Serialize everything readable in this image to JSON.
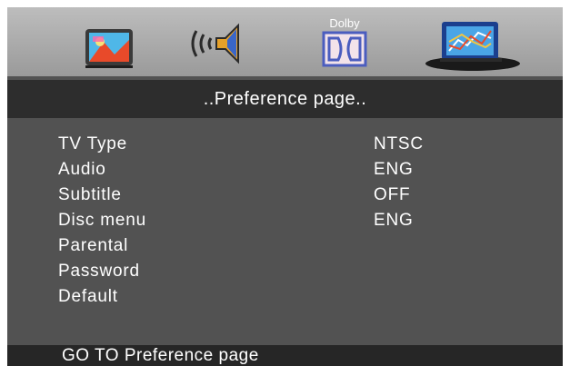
{
  "tabs": [
    {
      "name": "general-setup-icon"
    },
    {
      "name": "audio-setup-icon"
    },
    {
      "name": "dolby-setup-icon",
      "label": "Dolby"
    },
    {
      "name": "preference-setup-icon",
      "selected": true
    }
  ],
  "header": {
    "title": "..Preference page.."
  },
  "menu": {
    "items": [
      {
        "label": "TV Type",
        "value": "NTSC"
      },
      {
        "label": "Audio",
        "value": "ENG"
      },
      {
        "label": "Subtitle",
        "value": "OFF"
      },
      {
        "label": "Disc menu",
        "value": "ENG"
      },
      {
        "label": "Parental"
      },
      {
        "label": "Password"
      },
      {
        "label": "Default"
      }
    ]
  },
  "status": {
    "text": "GO TO Preference page"
  },
  "colors": {
    "screen_bg": "#525252",
    "header_bg": "#2d2d2d",
    "status_bg": "#262626",
    "text": "#ffffff"
  }
}
